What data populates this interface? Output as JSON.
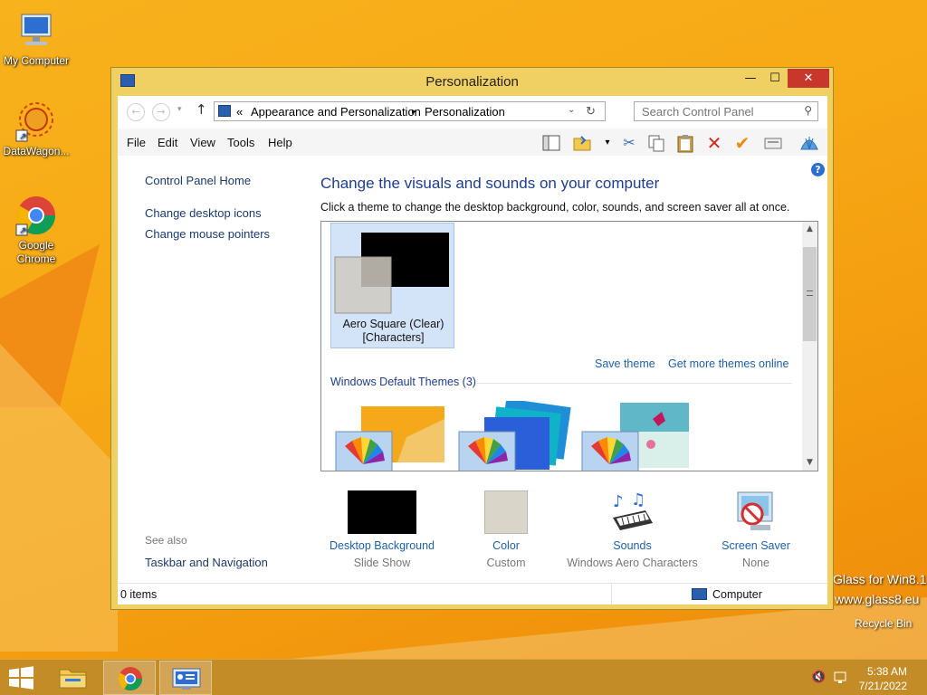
{
  "desktop": {
    "icons": [
      {
        "label": "My Computer",
        "icon": "computer-icon"
      },
      {
        "label": "DataWagon...",
        "icon": "datawagon-icon"
      },
      {
        "label": "Google Chrome",
        "icon": "chrome-icon"
      }
    ],
    "recycle_bin": "Recycle Bin",
    "watermark_line1": "Glass for Win8.1",
    "watermark_line2": "www.glass8.eu"
  },
  "window": {
    "title": "Personalization",
    "controls": {
      "minimize": "—",
      "maximize": "☐",
      "close": "✕"
    }
  },
  "address": {
    "chevron": "«",
    "crumb1": "Appearance and Personalization",
    "sep": "▸",
    "crumb2": "Personalization"
  },
  "search": {
    "placeholder": "Search Control Panel"
  },
  "menu": {
    "file": "File",
    "edit": "Edit",
    "view": "View",
    "tools": "Tools",
    "help": "Help"
  },
  "left_pane": {
    "home": "Control Panel Home",
    "desktop_icons": "Change desktop icons",
    "mouse_pointers": "Change mouse pointers",
    "see_also": "See also",
    "taskbar_nav": "Taskbar and Navigation"
  },
  "main": {
    "heading": "Change the visuals and sounds on your computer",
    "subtext": "Click a theme to change the desktop background, color, sounds, and screen saver all at once.",
    "selected_theme_line1": "Aero Square (Clear)",
    "selected_theme_line2": "[Characters]",
    "save_theme": "Save theme",
    "get_more": "Get more themes online",
    "group_title": "Windows Default Themes (3)"
  },
  "bottom": [
    {
      "link": "Desktop Background",
      "sub": "Slide Show"
    },
    {
      "link": "Color",
      "sub": "Custom"
    },
    {
      "link": "Sounds",
      "sub": "Windows Aero Characters"
    },
    {
      "link": "Screen Saver",
      "sub": "None"
    }
  ],
  "status": {
    "items": "0 items",
    "location": "Computer"
  },
  "taskbar": {
    "time": "5:38 AM",
    "date": "7/21/2022"
  },
  "colors": {
    "accent_link": "#1e5fa8",
    "heading": "#1e3d8f",
    "window_frame": "#f0cf63",
    "taskbar": "#c48c26"
  }
}
